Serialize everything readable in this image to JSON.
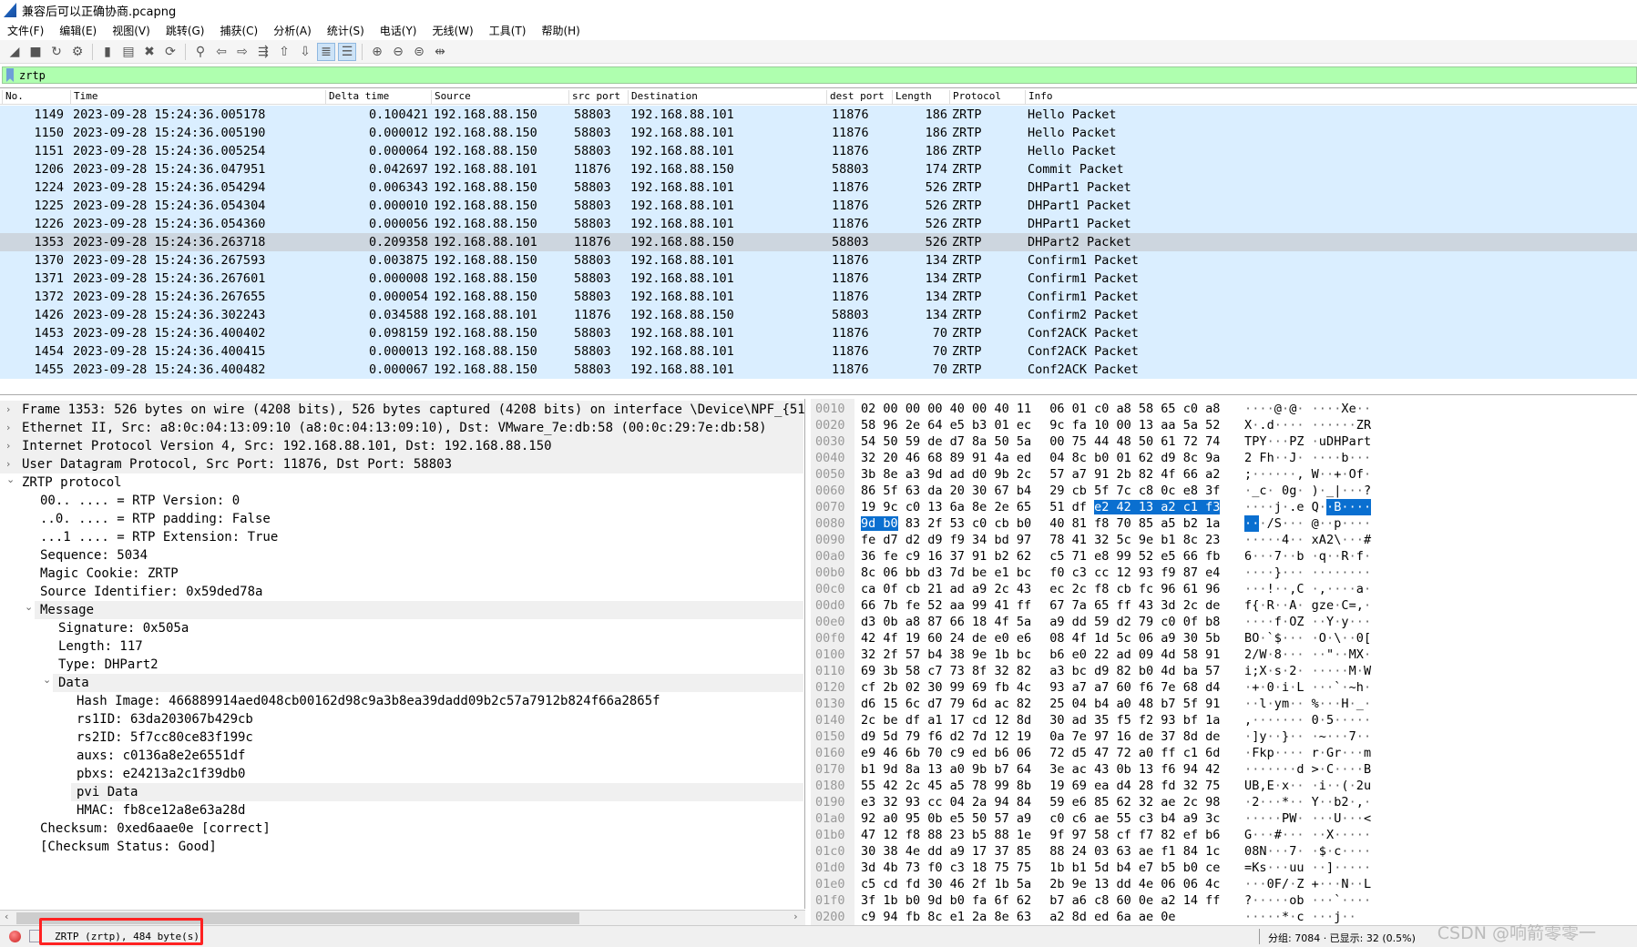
{
  "window": {
    "title": "兼容后可以正确协商.pcapng"
  },
  "menu": [
    "文件(F)",
    "编辑(E)",
    "视图(V)",
    "跳转(G)",
    "捕获(C)",
    "分析(A)",
    "统计(S)",
    "电话(Y)",
    "无线(W)",
    "工具(T)",
    "帮助(H)"
  ],
  "toolbar": {
    "icons": [
      [
        "start-capture-icon",
        "◢"
      ],
      [
        "stop-capture-icon",
        "■"
      ],
      [
        "restart-capture-icon",
        "↻"
      ],
      [
        "capture-options-icon",
        "⚙"
      ],
      null,
      [
        "open-file-icon",
        "▮"
      ],
      [
        "save-file-icon",
        "▤"
      ],
      [
        "close-file-icon",
        "✖"
      ],
      [
        "reload-icon",
        "⟳"
      ],
      null,
      [
        "find-packet-icon",
        "⚲"
      ],
      [
        "go-back-icon",
        "⇦"
      ],
      [
        "go-forward-icon",
        "⇨"
      ],
      [
        "go-to-packet-icon",
        "⇶"
      ],
      [
        "go-first-icon",
        "⇧"
      ],
      [
        "go-last-icon",
        "⇩"
      ],
      [
        "auto-scroll-icon",
        "≣"
      ],
      [
        "colorize-icon",
        "☰"
      ],
      null,
      [
        "zoom-in-icon",
        "⊕"
      ],
      [
        "zoom-out-icon",
        "⊖"
      ],
      [
        "zoom-normal-icon",
        "⊜"
      ],
      [
        "resize-columns-icon",
        "⇹"
      ]
    ],
    "active": [
      "auto-scroll-icon",
      "colorize-icon"
    ]
  },
  "filter": {
    "value": "zrtp"
  },
  "packet_list": {
    "columns": [
      "No.",
      "Time",
      "Delta time",
      "Source",
      "src port",
      "Destination",
      "dest port",
      "Length",
      "Protocol",
      "Info"
    ],
    "selected_no": "1353",
    "rows": [
      [
        "1149",
        "2023-09-28 15:24:36.005178",
        "0.100421",
        "192.168.88.150",
        "58803",
        "192.168.88.101",
        "11876",
        "186",
        "ZRTP",
        "Hello Packet"
      ],
      [
        "1150",
        "2023-09-28 15:24:36.005190",
        "0.000012",
        "192.168.88.150",
        "58803",
        "192.168.88.101",
        "11876",
        "186",
        "ZRTP",
        "Hello Packet"
      ],
      [
        "1151",
        "2023-09-28 15:24:36.005254",
        "0.000064",
        "192.168.88.150",
        "58803",
        "192.168.88.101",
        "11876",
        "186",
        "ZRTP",
        "Hello Packet"
      ],
      [
        "1206",
        "2023-09-28 15:24:36.047951",
        "0.042697",
        "192.168.88.101",
        "11876",
        "192.168.88.150",
        "58803",
        "174",
        "ZRTP",
        "Commit Packet"
      ],
      [
        "1224",
        "2023-09-28 15:24:36.054294",
        "0.006343",
        "192.168.88.150",
        "58803",
        "192.168.88.101",
        "11876",
        "526",
        "ZRTP",
        "DHPart1 Packet"
      ],
      [
        "1225",
        "2023-09-28 15:24:36.054304",
        "0.000010",
        "192.168.88.150",
        "58803",
        "192.168.88.101",
        "11876",
        "526",
        "ZRTP",
        "DHPart1 Packet"
      ],
      [
        "1226",
        "2023-09-28 15:24:36.054360",
        "0.000056",
        "192.168.88.150",
        "58803",
        "192.168.88.101",
        "11876",
        "526",
        "ZRTP",
        "DHPart1 Packet"
      ],
      [
        "1353",
        "2023-09-28 15:24:36.263718",
        "0.209358",
        "192.168.88.101",
        "11876",
        "192.168.88.150",
        "58803",
        "526",
        "ZRTP",
        "DHPart2 Packet"
      ],
      [
        "1370",
        "2023-09-28 15:24:36.267593",
        "0.003875",
        "192.168.88.150",
        "58803",
        "192.168.88.101",
        "11876",
        "134",
        "ZRTP",
        "Confirm1 Packet"
      ],
      [
        "1371",
        "2023-09-28 15:24:36.267601",
        "0.000008",
        "192.168.88.150",
        "58803",
        "192.168.88.101",
        "11876",
        "134",
        "ZRTP",
        "Confirm1 Packet"
      ],
      [
        "1372",
        "2023-09-28 15:24:36.267655",
        "0.000054",
        "192.168.88.150",
        "58803",
        "192.168.88.101",
        "11876",
        "134",
        "ZRTP",
        "Confirm1 Packet"
      ],
      [
        "1426",
        "2023-09-28 15:24:36.302243",
        "0.034588",
        "192.168.88.101",
        "11876",
        "192.168.88.150",
        "58803",
        "134",
        "ZRTP",
        "Confirm2 Packet"
      ],
      [
        "1453",
        "2023-09-28 15:24:36.400402",
        "0.098159",
        "192.168.88.150",
        "58803",
        "192.168.88.101",
        "11876",
        "70",
        "ZRTP",
        "Conf2ACK Packet"
      ],
      [
        "1454",
        "2023-09-28 15:24:36.400415",
        "0.000013",
        "192.168.88.150",
        "58803",
        "192.168.88.101",
        "11876",
        "70",
        "ZRTP",
        "Conf2ACK Packet"
      ],
      [
        "1455",
        "2023-09-28 15:24:36.400482",
        "0.000067",
        "192.168.88.150",
        "58803",
        "192.168.88.101",
        "11876",
        "70",
        "ZRTP",
        "Conf2ACK Packet"
      ]
    ]
  },
  "details": [
    {
      "text": "Frame 1353: 526 bytes on wire (4208 bits), 526 bytes captured (4208 bits) on interface \\Device\\NPF_{5101",
      "level": 0,
      "expander": "collapsed",
      "state": "gray"
    },
    {
      "text": "Ethernet II, Src: a8:0c:04:13:09:10 (a8:0c:04:13:09:10), Dst: VMware_7e:db:58 (00:0c:29:7e:db:58)",
      "level": 0,
      "expander": "collapsed",
      "state": "gray"
    },
    {
      "text": "Internet Protocol Version 4, Src: 192.168.88.101, Dst: 192.168.88.150",
      "level": 0,
      "expander": "collapsed",
      "state": "gray"
    },
    {
      "text": "User Datagram Protocol, Src Port: 11876, Dst Port: 58803",
      "level": 0,
      "expander": "collapsed",
      "state": "gray"
    },
    {
      "text": "ZRTP protocol",
      "level": 0,
      "expander": "expanded",
      "state": "selected"
    },
    {
      "text": "00.. .... = RTP Version: 0",
      "level": 1
    },
    {
      "text": "..0. .... = RTP padding: False",
      "level": 1
    },
    {
      "text": "...1 .... = RTP Extension: True",
      "level": 1
    },
    {
      "text": "Sequence: 5034",
      "level": 1
    },
    {
      "text": "Magic Cookie: ZRTP",
      "level": 1
    },
    {
      "text": "Source Identifier: 0x59ded78a",
      "level": 1
    },
    {
      "text": "Message",
      "level": 1,
      "expander": "expanded",
      "state": "gray"
    },
    {
      "text": "Signature: 0x505a",
      "level": 2
    },
    {
      "text": "Length: 117",
      "level": 2
    },
    {
      "text": "Type: DHPart2",
      "level": 2
    },
    {
      "text": "Data",
      "level": 2,
      "expander": "expanded",
      "state": "gray"
    },
    {
      "text": "Hash Image: 466889914aed048cb00162d98c9a3b8ea39dadd09b2c57a7912b824f66a2865f",
      "level": 3
    },
    {
      "text": "rs1ID: 63da203067b429cb",
      "level": 3
    },
    {
      "text": "rs2ID: 5f7cc80ce83f199c",
      "level": 3
    },
    {
      "text": "auxs: c0136a8e2e6551df",
      "level": 3
    },
    {
      "text": "pbxs: e24213a2c1f39db0",
      "level": 3
    },
    {
      "text": "pvi Data",
      "level": 3,
      "state": "gray"
    },
    {
      "text": "HMAC: fb8ce12a8e63a28d",
      "level": 3
    },
    {
      "text": "Checksum: 0xed6aae0e [correct]",
      "level": 1
    },
    {
      "text": "[Checksum Status: Good]",
      "level": 1
    }
  ],
  "hex": {
    "highlight_bytes": [
      122,
      129
    ],
    "rows": [
      [
        "0010",
        "02 00 00 00 40 00 40 11 06 01 c0 a8 58 65 c0 a8"
      ],
      [
        "0020",
        "58 96 2e 64 e5 b3 01 ec 9c fa 10 00 13 aa 5a 52"
      ],
      [
        "0030",
        "54 50 59 de d7 8a 50 5a 00 75 44 48 50 61 72 74"
      ],
      [
        "0040",
        "32 20 46 68 89 91 4a ed 04 8c b0 01 62 d9 8c 9a"
      ],
      [
        "0050",
        "3b 8e a3 9d ad d0 9b 2c 57 a7 91 2b 82 4f 66 a2"
      ],
      [
        "0060",
        "86 5f 63 da 20 30 67 b4 29 cb 5f 7c c8 0c e8 3f"
      ],
      [
        "0070",
        "19 9c c0 13 6a 8e 2e 65 51 df e2 42 13 a2 c1 f3"
      ],
      [
        "0080",
        "9d b0 83 2f 53 c0 cb b0 40 81 f8 70 85 a5 b2 1a"
      ],
      [
        "0090",
        "fe d7 d2 d9 f9 34 bd 97 78 41 32 5c 9e b1 8c 23"
      ],
      [
        "00a0",
        "36 fe c9 16 37 91 b2 62 c5 71 e8 99 52 e5 66 fb"
      ],
      [
        "00b0",
        "8c 06 bb d3 7d be e1 bc f0 c3 cc 12 93 f9 87 e4"
      ],
      [
        "00c0",
        "ca 0f cb 21 ad a9 2c 43 ec 2c f8 cb fc 96 61 96"
      ],
      [
        "00d0",
        "66 7b fe 52 aa 99 41 ff 67 7a 65 ff 43 3d 2c de"
      ],
      [
        "00e0",
        "d3 0b a8 87 66 18 4f 5a a9 dd 59 d2 79 c0 0f b8"
      ],
      [
        "00f0",
        "42 4f 19 60 24 de e0 e6 08 4f 1d 5c 06 a9 30 5b"
      ],
      [
        "0100",
        "32 2f 57 b4 38 9e 1b bc b6 e0 22 ad 09 4d 58 91"
      ],
      [
        "0110",
        "69 3b 58 c7 73 8f 32 82 a3 bc d9 82 b0 4d ba 57"
      ],
      [
        "0120",
        "cf 2b 02 30 99 69 fb 4c 93 a7 a7 60 f6 7e 68 d4"
      ],
      [
        "0130",
        "d6 15 6c d7 79 6d ac 82 25 04 b4 a0 48 b7 5f 91"
      ],
      [
        "0140",
        "2c be df a1 17 cd 12 8d 30 ad 35 f5 f2 93 bf 1a"
      ],
      [
        "0150",
        "d9 5d 79 f6 d2 7d 12 19 0a 7e 97 16 de 37 8d de"
      ],
      [
        "0160",
        "e9 46 6b 70 c9 ed b6 06 72 d5 47 72 a0 ff c1 6d"
      ],
      [
        "0170",
        "b1 9d 8a 13 a0 9b b7 64 3e ac 43 0b 13 f6 94 42"
      ],
      [
        "0180",
        "55 42 2c 45 a5 78 99 8b 19 69 ea d4 28 fd 32 75"
      ],
      [
        "0190",
        "e3 32 93 cc 04 2a 94 84 59 e6 85 62 32 ae 2c 98"
      ],
      [
        "01a0",
        "92 a0 95 0b e5 50 57 a9 c0 c6 ae 55 c3 b4 a9 3c"
      ],
      [
        "01b0",
        "47 12 f8 88 23 b5 88 1e 9f 97 58 cf f7 82 ef b6"
      ],
      [
        "01c0",
        "30 38 4e dd a9 17 37 85 88 24 03 63 ae f1 84 1c"
      ],
      [
        "01d0",
        "3d 4b 73 f0 c3 18 75 75 1b b1 5d b4 e7 b5 b0 ce"
      ],
      [
        "01e0",
        "c5 cd fd 30 46 2f 1b 5a 2b 9e 13 dd 4e 06 06 4c"
      ],
      [
        "01f0",
        "3f 1b b0 9d b0 fa 6f 62 b7 a6 c8 60 0e a2 14 ff"
      ],
      [
        "0200",
        "c9 94 fb 8c e1 2a 8e 63 a2 8d ed 6a ae 0e"
      ]
    ]
  },
  "status": {
    "field_info": "ZRTP (zrtp), 484 byte(s)",
    "packets": "分组: 7084 · 已显示: 32 (0.5%)",
    "watermark": "CSDN @响箭零零一"
  },
  "colors": {
    "row_bg": "#daeeff",
    "selected_row": "#cdd6df",
    "filter_ok": "#afffaf",
    "byte_highlight": "#0a6fd0",
    "annotation": "#ff2222"
  }
}
